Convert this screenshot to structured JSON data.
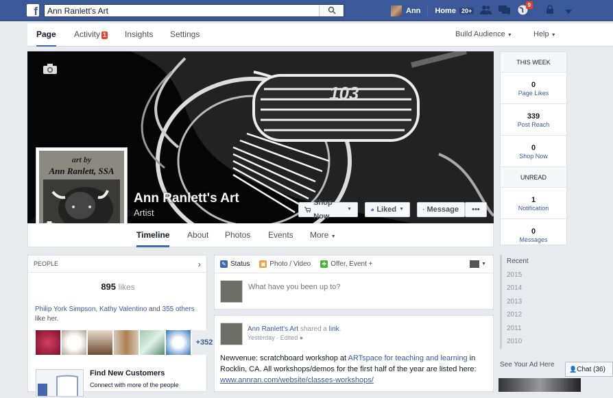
{
  "topbar": {
    "logo": "f",
    "search_value": "Ann Ranlett's Art",
    "user_name": "Ann",
    "home_label": "Home",
    "home_count": "20+",
    "notifications_count": "9"
  },
  "subnav": {
    "tabs": [
      {
        "label": "Page"
      },
      {
        "label": "Activity",
        "badge": "1"
      },
      {
        "label": "Insights"
      },
      {
        "label": "Settings"
      }
    ],
    "build_audience": "Build Audience",
    "help": "Help"
  },
  "profile": {
    "name": "Ann Ranlett's Art",
    "category": "Artist",
    "pic_line1": "art by",
    "pic_line2": "Ann Ranlett, SSA"
  },
  "cover_buttons": {
    "shop_now": "Shop Now",
    "liked": "Liked",
    "message": "Message",
    "more": "•••"
  },
  "timeline_nav": {
    "items": [
      "Timeline",
      "About",
      "Photos",
      "Events",
      "More"
    ]
  },
  "this_week": {
    "header": "THIS WEEK",
    "stats": [
      {
        "value": "0",
        "label": "Page Likes"
      },
      {
        "value": "339",
        "label": "Post Reach"
      },
      {
        "value": "0",
        "label": "Shop Now"
      }
    ],
    "unread_header": "UNREAD",
    "unread": [
      {
        "value": "1",
        "label": "Notification"
      },
      {
        "value": "0",
        "label": "Messages"
      }
    ]
  },
  "people": {
    "header": "PEOPLE",
    "likes_count": "895",
    "likes_label": "likes",
    "friend1": "Philip York Simpson",
    "friend_sep": ", ",
    "friend2": "Kathy Valentino",
    "friend_and": " and ",
    "others": "355 others",
    "like_her": "like her.",
    "more_count": "+352",
    "find_title": "Find New Customers",
    "find_sub": "Connect with more of the people"
  },
  "composer": {
    "tabs": [
      "Status",
      "Photo / Video",
      "Offer, Event +"
    ],
    "placeholder": "What have you been up to?"
  },
  "post": {
    "author": "Ann Ranlett's Art",
    "shared_a": " shared a ",
    "link_word": "link",
    "time": "Yesterday",
    "edited": " · Edited",
    "text_a": "Newvenue: scratchboard workshop at ",
    "link1": "ARTspace for teaching and learning",
    "text_b": " in Rocklin, CA. All workshops/demos for the first half of the year are listed here: ",
    "url": "www.annran.com/website/classes-workshops/"
  },
  "years": [
    "Recent",
    "2015",
    "2014",
    "2013",
    "2012",
    "2011",
    "2010"
  ],
  "ad": {
    "header": "See Your Ad Here"
  },
  "chat": {
    "label": "Chat (36)"
  }
}
